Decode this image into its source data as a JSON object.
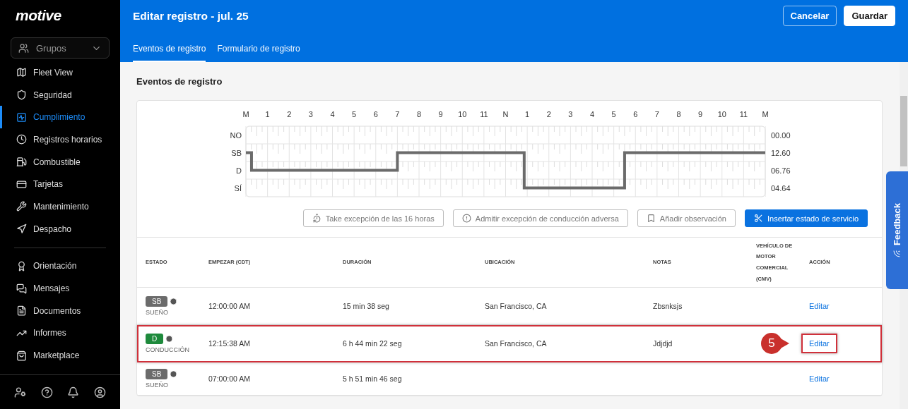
{
  "sidebar": {
    "logo": "motive",
    "group_select": {
      "label": "Grupos"
    },
    "items": [
      {
        "label": "Fleet View",
        "selected": false
      },
      {
        "label": "Seguridad",
        "selected": false
      },
      {
        "label": "Cumplimiento",
        "selected": true
      },
      {
        "label": "Registros horarios",
        "selected": false
      },
      {
        "label": "Combustible",
        "selected": false
      },
      {
        "label": "Tarjetas",
        "selected": false
      },
      {
        "label": "Mantenimiento",
        "selected": false
      },
      {
        "label": "Despacho",
        "selected": false
      }
    ],
    "items_2": [
      {
        "label": "Orientación",
        "selected": false
      },
      {
        "label": "Mensajes",
        "selected": false
      },
      {
        "label": "Documentos",
        "selected": false
      },
      {
        "label": "Informes",
        "selected": false
      },
      {
        "label": "Marketplace",
        "selected": false
      }
    ]
  },
  "header": {
    "title": "Editar registro - jul. 25",
    "buttons": [
      {
        "label": "Cancelar",
        "kind": "secondary"
      },
      {
        "label": "Guardar",
        "kind": "primary"
      }
    ],
    "tabs": [
      {
        "label": "Eventos de registro",
        "selected": true
      },
      {
        "label": "Formulario de registro",
        "selected": false
      }
    ]
  },
  "section_title": "Eventos de registro",
  "log_graph": {
    "hour_labels": [
      "M",
      "1",
      "2",
      "3",
      "4",
      "5",
      "6",
      "7",
      "8",
      "9",
      "10",
      "11",
      "N",
      "1",
      "2",
      "3",
      "4",
      "5",
      "6",
      "7",
      "8",
      "9",
      "10",
      "11",
      "M"
    ],
    "status_rows": [
      "NO",
      "SB",
      "D",
      "SÍ"
    ],
    "totals": [
      "00.00",
      "12.60",
      "06.76",
      "04.64"
    ]
  },
  "actions": [
    {
      "label": "Take excepción de las 16 horas",
      "kind": "outline"
    },
    {
      "label": "Admitir excepción de conducción adversa",
      "kind": "outline"
    },
    {
      "label": "Añadir observación",
      "kind": "outline"
    },
    {
      "label": "Insertar estado de servicio",
      "kind": "primary"
    }
  ],
  "table": {
    "columns": [
      "ESTADO",
      "EMPEZAR (CDT)",
      "DURACIÓN",
      "UBICACIÓN",
      "NOTAS",
      "VEHÍCULO DE MOTOR COMERCIAL (CMV)",
      "ACCIÓN"
    ],
    "rows": [
      {
        "status_code": "SB",
        "color": "#6b6b6b",
        "status": "SUEÑO",
        "start": "12:00:00 AM",
        "duration": "15 min 38 seg",
        "location": "San Francisco, CA",
        "notes": "Zbsnksjs",
        "action": "Editar",
        "highlighted": false
      },
      {
        "status_code": "D",
        "color": "#1e8a3c",
        "status": "CONDUCCIÓN",
        "start": "12:15:38 AM",
        "duration": "6 h 44 min 22 seg",
        "location": "San Francisco, CA",
        "notes": "Jdjdjd",
        "action": "Editar",
        "highlighted": true,
        "callout": "5"
      },
      {
        "status_code": "SB",
        "color": "#6b6b6b",
        "status": "SUEÑO",
        "start": "07:00:00 AM",
        "duration": "5 h 51 min 46 seg",
        "action": "Editar",
        "highlighted": false
      }
    ]
  },
  "feedback_tab": {
    "label": "Feedback"
  }
}
